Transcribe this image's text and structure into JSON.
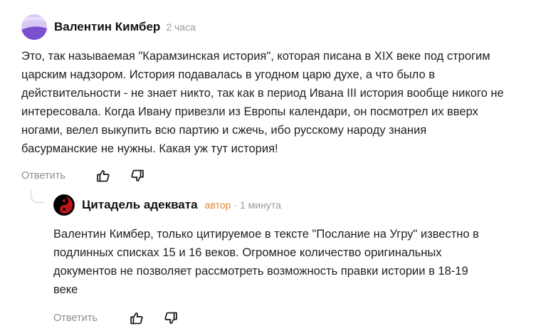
{
  "comments": [
    {
      "author": "Валентин Кимбер",
      "time": "2 часа",
      "avatar_colors": [
        "#c9b6e8",
        "#7a4fd0"
      ],
      "text": "Это, так называемая \"Карамзинская история\", которая писана в XIX веке под строгим царским надзором. История подавалась в угодном царю духе, а что было в действительности - не знает никто, так как в период Ивана III история вообще никого не интересовала. Когда Ивану привезли из Европы календари, он посмотрел их вверх ногами, велел выкупить всю партию и сжечь, ибо русскому народу знания басурманские не нужны. Какая уж тут история!",
      "reply_label": "Ответить",
      "like_icon": "thumbs-up-icon",
      "dislike_icon": "thumbs-down-icon"
    },
    {
      "author": "Цитадель адеквата",
      "badge": "автор",
      "separator": "·",
      "time": "1 минута",
      "avatar_colors": [
        "#000000",
        "#c0141c"
      ],
      "text": "Валентин Кимбер, только цитируемое в тексте \"Послание на Угру\" известно в подлинных списках 15 и 16 веков. Огромное количество оригинальных документов не позволяет рассмотреть возможность правки истории в 18-19 веке",
      "reply_label": "Ответить",
      "like_icon": "thumbs-up-icon",
      "dislike_icon": "thumbs-down-icon"
    }
  ]
}
